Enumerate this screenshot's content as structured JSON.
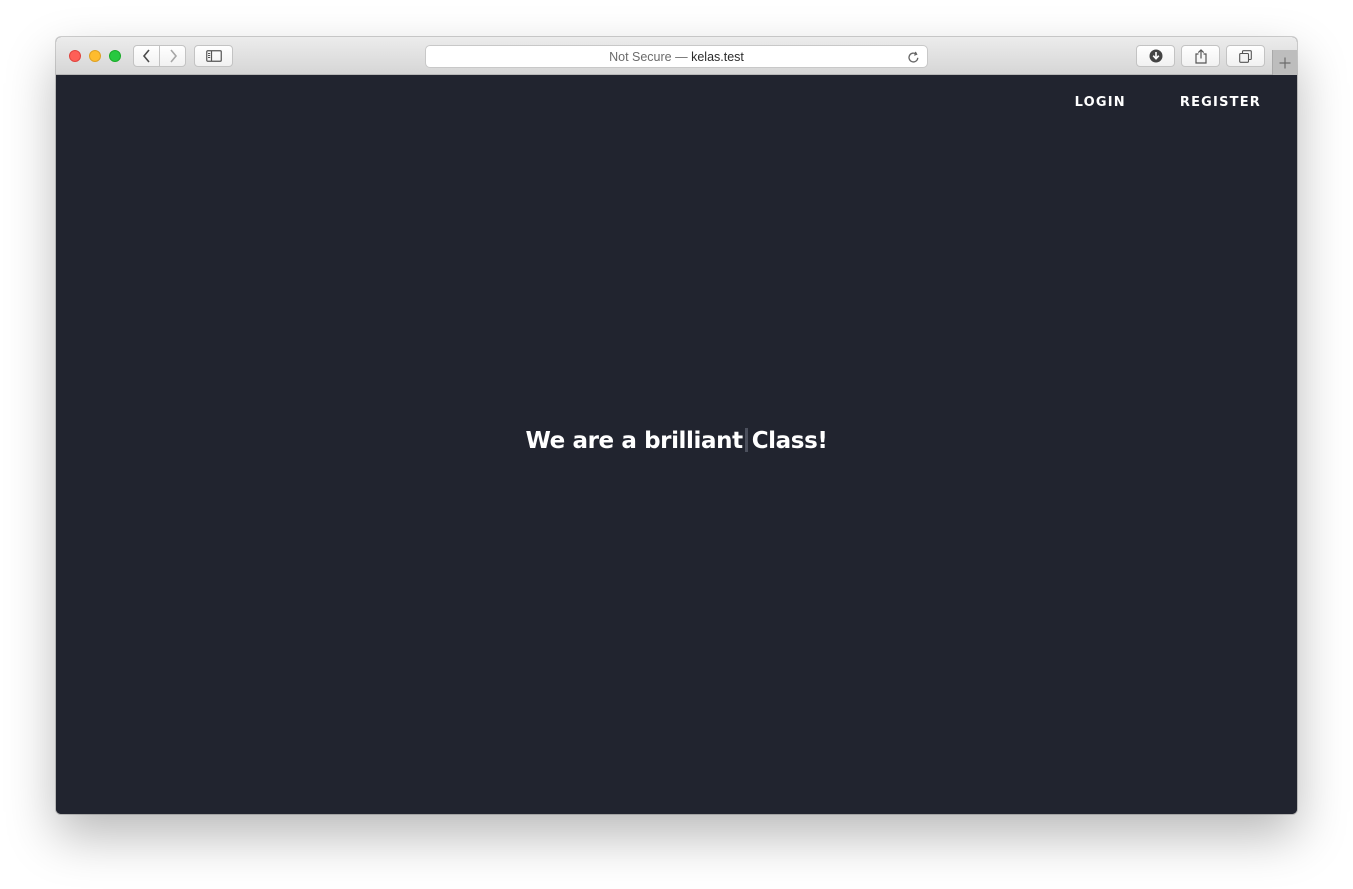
{
  "browser": {
    "address_secure_label": "Not Secure —",
    "address_host": "kelas.test",
    "colors": {
      "close": "#fe5f57",
      "minimize": "#febc2e",
      "maximize": "#28c840"
    }
  },
  "page": {
    "background_color": "#21242f",
    "nav": {
      "login_label": "LOGIN",
      "register_label": "REGISTER"
    },
    "hero": {
      "text_before_caret": "We are a brilliant",
      "text_after_caret": "Class!"
    }
  },
  "icons": {
    "back": "chevron-left-icon",
    "forward": "chevron-right-icon",
    "sidebar": "sidebar-icon",
    "reload": "reload-icon",
    "download": "download-icon",
    "share": "share-icon",
    "tabs": "tabs-overview-icon",
    "new_tab": "plus-icon"
  }
}
